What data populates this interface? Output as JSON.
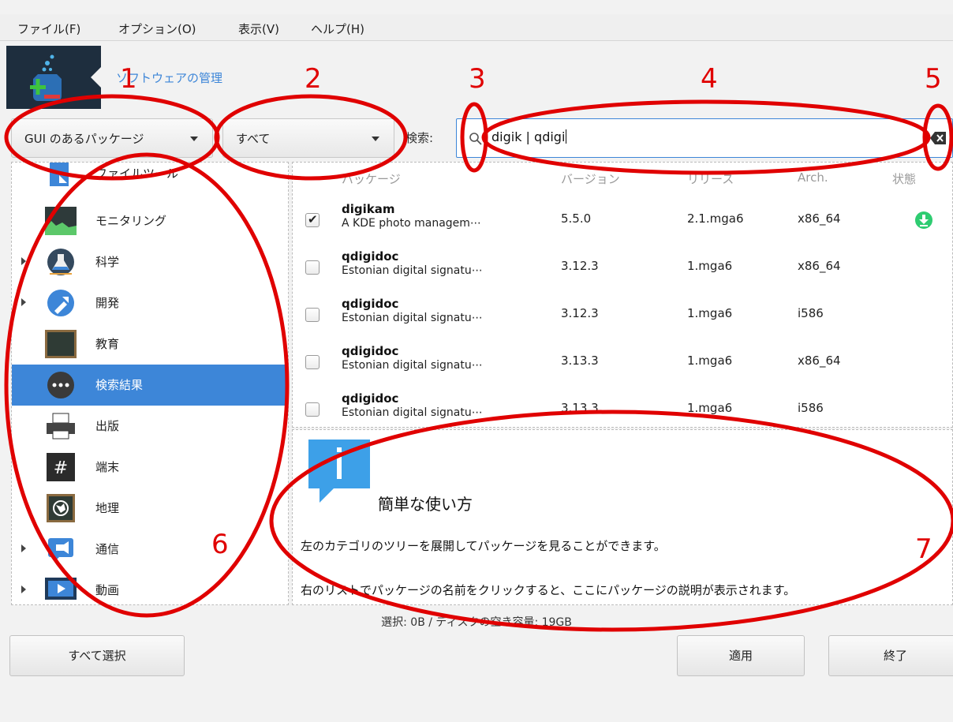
{
  "menubar": {
    "items": [
      "ファイル(F)",
      "オプション(O)",
      "表示(V)",
      "ヘルプ(H)"
    ]
  },
  "app": {
    "title": "ソフトウェアの管理"
  },
  "filters": {
    "type_combo": "GUI のあるパッケージ",
    "state_combo": "すべて"
  },
  "search": {
    "label": "検索:",
    "value": "digik | qdigi"
  },
  "categories": [
    {
      "label": "ファイルツール",
      "icon": "file-tools-icon",
      "expander": false
    },
    {
      "label": "モニタリング",
      "icon": "monitoring-icon",
      "expander": false
    },
    {
      "label": "科学",
      "icon": "science-icon",
      "expander": true
    },
    {
      "label": "開発",
      "icon": "development-icon",
      "expander": true
    },
    {
      "label": "教育",
      "icon": "education-icon",
      "expander": false
    },
    {
      "label": "検索結果",
      "icon": "search-results-icon",
      "expander": false,
      "selected": true
    },
    {
      "label": "出版",
      "icon": "printer-icon",
      "expander": false
    },
    {
      "label": "端末",
      "icon": "terminal-icon",
      "expander": false
    },
    {
      "label": "地理",
      "icon": "geography-icon",
      "expander": false
    },
    {
      "label": "通信",
      "icon": "communication-icon",
      "expander": true
    },
    {
      "label": "動画",
      "icon": "video-icon",
      "expander": true
    }
  ],
  "table": {
    "headers": [
      "パッケージ",
      "バージョン",
      "リリース",
      "Arch.",
      "状態"
    ],
    "rows": [
      {
        "name": "digikam",
        "desc": "A KDE photo managem⋯",
        "version": "5.5.0",
        "release": "2.1.mga6",
        "arch": "x86_64",
        "checked": true,
        "status": "install-icon"
      },
      {
        "name": "qdigidoc",
        "desc": "Estonian digital signatu⋯",
        "version": "3.12.3",
        "release": "1.mga6",
        "arch": "x86_64",
        "checked": false,
        "status": ""
      },
      {
        "name": "qdigidoc",
        "desc": "Estonian digital signatu⋯",
        "version": "3.12.3",
        "release": "1.mga6",
        "arch": "i586",
        "checked": false,
        "status": ""
      },
      {
        "name": "qdigidoc",
        "desc": "Estonian digital signatu⋯",
        "version": "3.13.3",
        "release": "1.mga6",
        "arch": "x86_64",
        "checked": false,
        "status": ""
      },
      {
        "name": "qdigidoc",
        "desc": "Estonian digital signatu⋯",
        "version": "3.13.3",
        "release": "1.mga6",
        "arch": "i586",
        "checked": false,
        "status": ""
      }
    ]
  },
  "info": {
    "heading": "簡単な使い方",
    "line1": "左のカテゴリのツリーを展開してパッケージを見ることができます。",
    "line2": "右のリストでパッケージの名前をクリックすると、ここにパッケージの説明が表示されます。"
  },
  "status": {
    "text": "選択: 0B / ディスクの空き容量: 19GB"
  },
  "buttons": {
    "select_all": "すべて選択",
    "apply": "適用",
    "quit": "終了"
  },
  "annotations": [
    "1",
    "2",
    "3",
    "4",
    "5",
    "6",
    "7"
  ],
  "colors": {
    "accent": "#3d86d8",
    "annotation": "#e00000",
    "install": "#2ecc71"
  }
}
